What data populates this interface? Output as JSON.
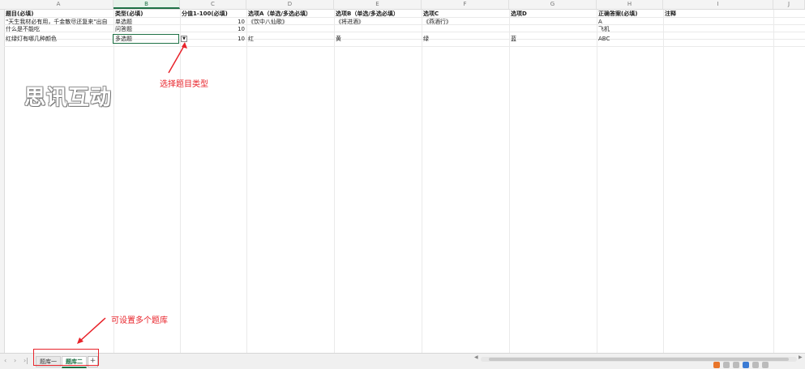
{
  "columns": [
    "A",
    "B",
    "C",
    "D",
    "E",
    "F",
    "G",
    "H",
    "I",
    "J"
  ],
  "header_row": [
    "题目(必填)",
    "类型(必填)",
    "分值1-100(必填)",
    "选项A（单选/多选必填）",
    "选项B（单选/多选必填）",
    "选项C",
    "选项D",
    "正确答案(必填)",
    "注释"
  ],
  "rows": [
    [
      "\"天生我材必有用，千金散尽还复来\"出自",
      "单选题",
      "10",
      "《饮中八仙歌》",
      "《将进酒》",
      "《燕酒行》",
      "",
      "A",
      ""
    ],
    [
      "什么是不能吃",
      "问答题",
      "10",
      "",
      "",
      "",
      "",
      "飞机",
      ""
    ],
    [
      "红绿灯有哪几种颜色",
      "多选题",
      "10",
      "红",
      "黄",
      "绿",
      "蓝",
      "ABC",
      ""
    ]
  ],
  "dropdown_icon": "chevron-down-icon",
  "watermark": "思讯互动",
  "annotations": {
    "type_hint": "选择题目类型",
    "bank_hint": "可设置多个题库"
  },
  "sheet_tabs": [
    "题库一",
    "题库二"
  ],
  "active_sheet": "题库二",
  "add_sheet_label": "+",
  "accent_color": "#1e7145",
  "annotation_color": "#e8232a"
}
